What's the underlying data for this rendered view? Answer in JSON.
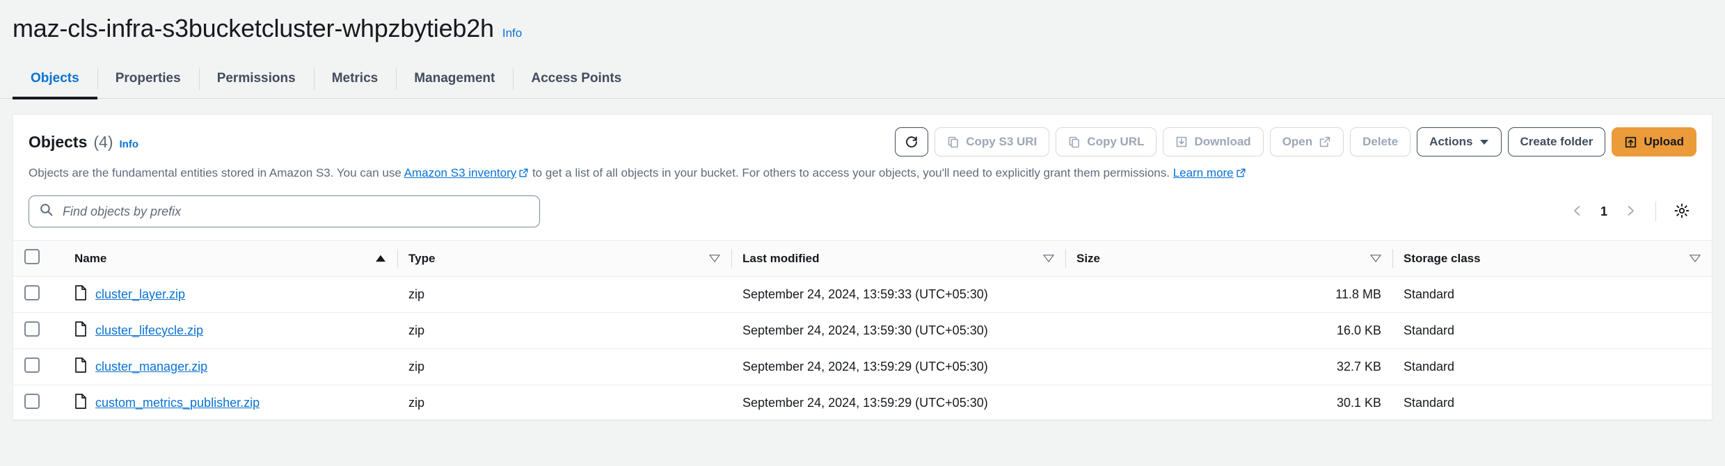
{
  "header": {
    "bucket_name": "maz-cls-infra-s3bucketcluster-whpzbytieb2h",
    "info_label": "Info"
  },
  "tabs": [
    {
      "label": "Objects",
      "active": true
    },
    {
      "label": "Properties",
      "active": false
    },
    {
      "label": "Permissions",
      "active": false
    },
    {
      "label": "Metrics",
      "active": false
    },
    {
      "label": "Management",
      "active": false
    },
    {
      "label": "Access Points",
      "active": false
    }
  ],
  "panel": {
    "title": "Objects",
    "count": "(4)",
    "info_label": "Info",
    "description_part1": "Objects are the fundamental entities stored in Amazon S3. You can use ",
    "description_link1": "Amazon S3 inventory",
    "description_part2": " to get a list of all objects in your bucket. For others to access your objects, you'll need to explicitly grant them permissions. ",
    "description_link2": "Learn more"
  },
  "toolbar": {
    "refresh_icon": "refresh-icon",
    "copy_s3_uri_label": "Copy S3 URI",
    "copy_url_label": "Copy URL",
    "download_label": "Download",
    "open_label": "Open",
    "delete_label": "Delete",
    "actions_label": "Actions",
    "create_folder_label": "Create folder",
    "upload_label": "Upload"
  },
  "search": {
    "placeholder": "Find objects by prefix",
    "value": ""
  },
  "pagination": {
    "prev_icon": "chevron-left-icon",
    "page": "1",
    "next_icon": "chevron-right-icon",
    "settings_icon": "gear-icon"
  },
  "table": {
    "columns": [
      {
        "label": "Name",
        "sort": "asc"
      },
      {
        "label": "Type",
        "sort": "none"
      },
      {
        "label": "Last modified",
        "sort": "none"
      },
      {
        "label": "Size",
        "sort": "none"
      },
      {
        "label": "Storage class",
        "sort": "none"
      }
    ],
    "rows": [
      {
        "name": "cluster_layer.zip",
        "type": "zip",
        "last_modified": "September 24, 2024, 13:59:33 (UTC+05:30)",
        "size": "11.8 MB",
        "storage_class": "Standard"
      },
      {
        "name": "cluster_lifecycle.zip",
        "type": "zip",
        "last_modified": "September 24, 2024, 13:59:30 (UTC+05:30)",
        "size": "16.0 KB",
        "storage_class": "Standard"
      },
      {
        "name": "cluster_manager.zip",
        "type": "zip",
        "last_modified": "September 24, 2024, 13:59:29 (UTC+05:30)",
        "size": "32.7 KB",
        "storage_class": "Standard"
      },
      {
        "name": "custom_metrics_publisher.zip",
        "type": "zip",
        "last_modified": "September 24, 2024, 13:59:29 (UTC+05:30)",
        "size": "30.1 KB",
        "storage_class": "Standard"
      }
    ]
  },
  "colors": {
    "accent_link": "#0972d3",
    "primary_button": "#eb9b39",
    "text_default": "#16191f",
    "text_muted": "#5f6b7a",
    "page_background": "#f2f3f3"
  }
}
